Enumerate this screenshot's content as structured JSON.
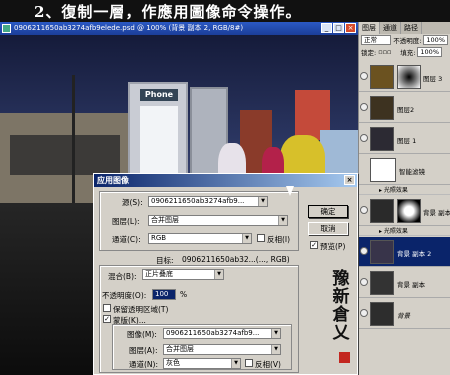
{
  "banner": {
    "text": "2、復制一層，作應用圖像命令操作。"
  },
  "document": {
    "title": "0906211650ab3274afb9elede.psd @ 100% (背景 副本 2, RGB/8#)",
    "booth_label": "Phone"
  },
  "window_buttons": [
    "_",
    "□",
    "×"
  ],
  "layers_panel": {
    "tabs": [
      "图层",
      "通道",
      "路径"
    ],
    "blend_mode": "正常",
    "opacity_label": "不透明度:",
    "opacity_value": "100%",
    "lock_label": "锁定:",
    "fill_label": "填充:",
    "fill_value": "100%",
    "layers": [
      {
        "name": "图层 3",
        "active": false
      },
      {
        "name": "图层2",
        "active": false
      },
      {
        "name": "图层 1",
        "active": false
      },
      {
        "name": "智能滤镜",
        "active": false
      },
      {
        "name": "背景 副本 3",
        "active": false
      },
      {
        "name": "背景 副本 2",
        "active": true
      },
      {
        "name": "背景 副本",
        "active": false
      },
      {
        "name": "背景",
        "active": false
      }
    ],
    "effects": [
      "▸ 光照效果",
      "▸ 光照效果"
    ]
  },
  "dialog": {
    "title": "应用图像",
    "source_label": "源(S):",
    "source_value": "0906211650ab3274afb9...",
    "layer_label": "图层(L):",
    "layer_value": "合并图层",
    "channel_label": "通道(C):",
    "channel_value": "RGB",
    "invert_label": "反相(I)",
    "target_label": "目标:",
    "target_value": "0906211650ab32...(..., RGB)",
    "blending_label": "混合(B):",
    "blending_value": "正片叠底",
    "opacity_label": "不透明度(O):",
    "opacity_value": "100",
    "opacity_unit": "%",
    "preserve_label": "保留透明区域(T)",
    "mask_label": "蒙版(K)...",
    "image_label": "图像(M):",
    "image_value": "0906211650ab3274afb9...",
    "mask_layer_label": "图层(A):",
    "mask_layer_value": "合并图层",
    "mask_channel_label": "通道(N):",
    "mask_channel_value": "灰色",
    "mask_invert_label": "反相(V)",
    "ok_button": "确定",
    "cancel_button": "取消",
    "preview_label": "预览(P)",
    "checked_mark": "✓"
  },
  "calligraphy": "豫新倉乂"
}
